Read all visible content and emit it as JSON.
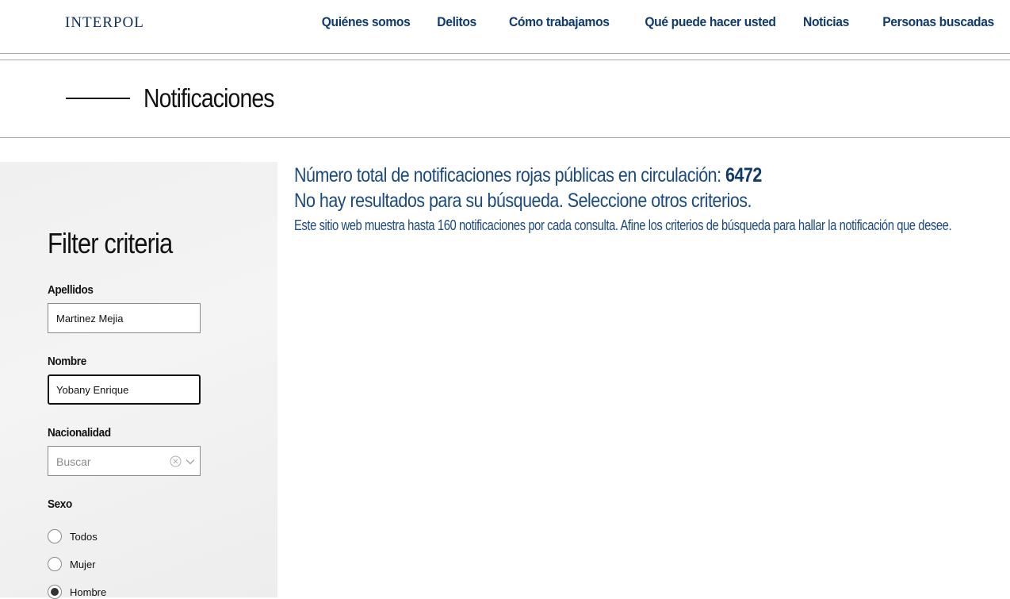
{
  "header": {
    "logo": "INTERPOL",
    "nav": [
      "Quiénes somos",
      "Delitos",
      "Cómo trabajamos",
      "Qué puede hacer usted",
      "Noticias",
      "Personas buscadas"
    ]
  },
  "page": {
    "title": "Notificaciones"
  },
  "sidebar": {
    "title": "Filter criteria",
    "surname": {
      "label": "Apellidos",
      "value": "Martinez Mejia"
    },
    "forename": {
      "label": "Nombre",
      "value": "Yobany Enrique"
    },
    "nationality": {
      "label": "Nacionalidad",
      "placeholder": "Buscar",
      "icons": [
        "clear-icon",
        "chevron-down-icon"
      ]
    },
    "sex": {
      "label": "Sexo",
      "options": [
        "Todos",
        "Mujer",
        "Hombre"
      ],
      "selected": "Hombre"
    }
  },
  "results": {
    "total_text": "Número total de notificaciones rojas públicas en circulación:",
    "total_count": "6472",
    "no_results_text": "No hay resultados para su búsqueda. Seleccione otros criterios.",
    "info_text": "Este sitio web muestra hasta 160 notificaciones por cada consulta. Afine los criterios de búsqueda para hallar la notificación que desee."
  },
  "colors": {
    "brand_navy": "#0f3a6b",
    "text_blue": "#1c4a7d",
    "sidebar_bg": "#f0f0f0"
  }
}
